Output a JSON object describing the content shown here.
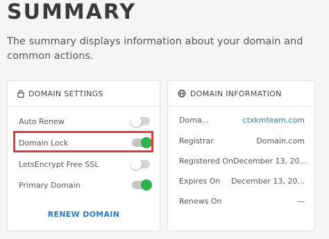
{
  "page": {
    "title": "SUMMARY",
    "subtitle": "The summary displays information about your domain and common actions."
  },
  "domain_settings": {
    "header": "DOMAIN SETTINGS",
    "items": [
      {
        "label": "Auto Renew",
        "enabled": false
      },
      {
        "label": "Domain Lock",
        "enabled": true
      },
      {
        "label": "LetsEncrypt Free SSL",
        "enabled": false
      },
      {
        "label": "Primary Domain",
        "enabled": true
      }
    ],
    "renew_label": "RENEW DOMAIN"
  },
  "domain_information": {
    "header": "DOMAIN INFORMATION",
    "rows": [
      {
        "label": "Doma...",
        "value": "ctxkmteam.com"
      },
      {
        "label": "Registrar",
        "value": "Domain.com"
      },
      {
        "label": "Registered On",
        "value": "December 13, 20..."
      },
      {
        "label": "Expires On",
        "value": "December 13, 20..."
      },
      {
        "label": "Renews On",
        "value": "—"
      }
    ]
  },
  "colors": {
    "toggle_on": "#2bb24c",
    "link": "#2a7bbd",
    "highlight": "#e03a3e"
  }
}
